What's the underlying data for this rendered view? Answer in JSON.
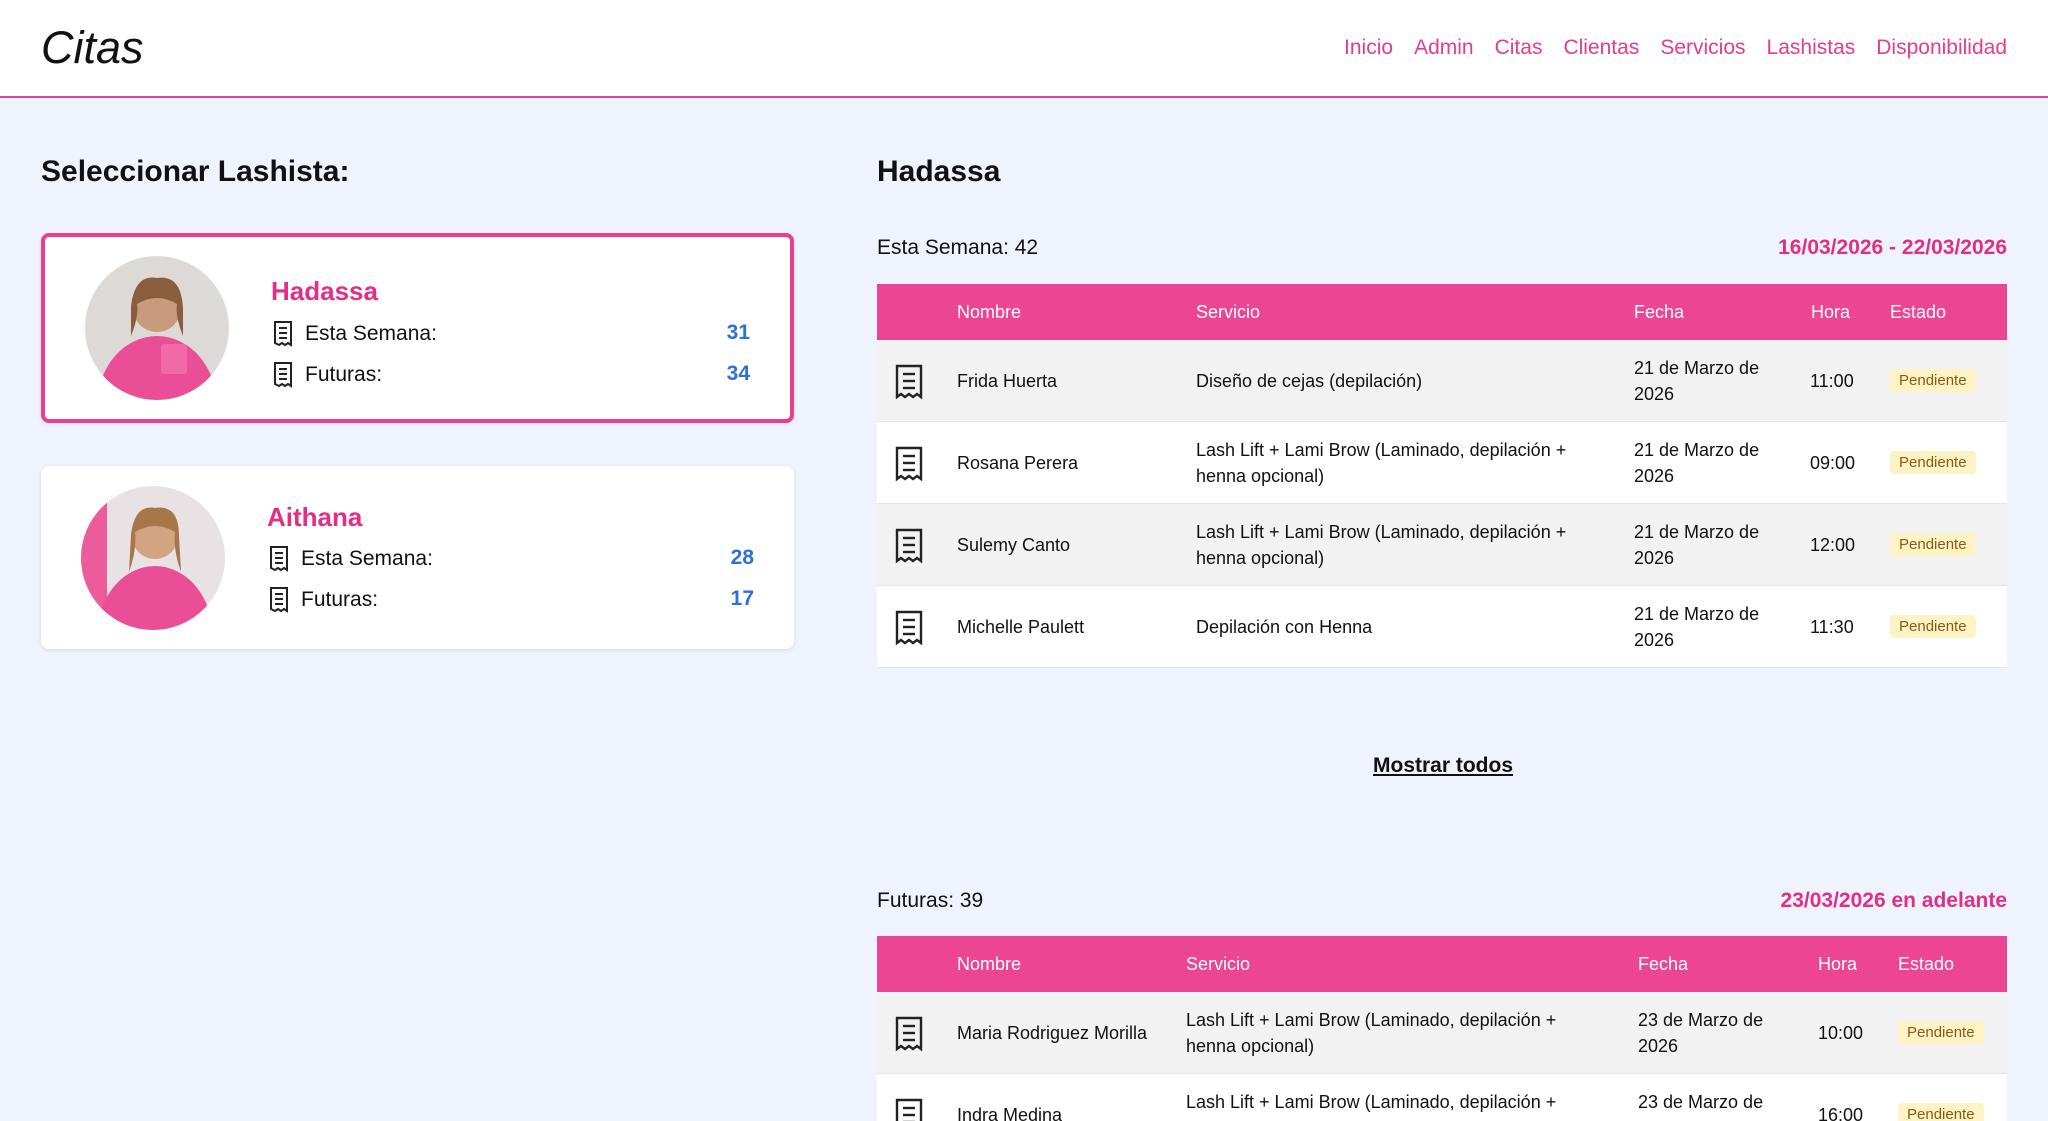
{
  "nav": {
    "brand": "Citas",
    "links": [
      "Inicio",
      "Admin",
      "Citas",
      "Clientas",
      "Servicios",
      "Lashistas",
      "Disponibilidad"
    ]
  },
  "left": {
    "title": "Seleccionar Lashista:",
    "lashistas": [
      {
        "name": "Hadassa",
        "week_label": "Esta Semana:",
        "week": "31",
        "future_label": "Futuras:",
        "future": "34",
        "selected": true
      },
      {
        "name": "Aithana",
        "week_label": "Esta Semana:",
        "week": "28",
        "future_label": "Futuras:",
        "future": "17",
        "selected": false
      }
    ]
  },
  "right": {
    "title": "Hadassa",
    "week": {
      "label": "Esta Semana: 42",
      "range": "16/03/2026 - 22/03/2026",
      "headers": {
        "nombre": "Nombre",
        "servicio": "Servicio",
        "fecha": "Fecha",
        "hora": "Hora",
        "estado": "Estado"
      },
      "rows": [
        {
          "nombre": "Frida Huerta",
          "servicio": "Diseño de cejas (depilación)",
          "fecha1": "21 de Marzo de",
          "fecha2": "2026",
          "hora": "11:00",
          "estado": "Pendiente"
        },
        {
          "nombre": "Rosana Perera",
          "servicio1": "Lash Lift + Lami Brow (Laminado, depilación +",
          "servicio2": "henna opcional)",
          "fecha1": "21 de Marzo de",
          "fecha2": "2026",
          "hora": "09:00",
          "estado": "Pendiente"
        },
        {
          "nombre": "Sulemy Canto",
          "servicio1": "Lash Lift + Lami Brow (Laminado, depilación +",
          "servicio2": "henna opcional)",
          "fecha1": "21 de Marzo de",
          "fecha2": "2026",
          "hora": "12:00",
          "estado": "Pendiente"
        },
        {
          "nombre": "Michelle Paulett",
          "servicio": "Depilación con Henna",
          "fecha1": "21 de Marzo de",
          "fecha2": "2026",
          "hora": "11:30",
          "estado": "Pendiente"
        }
      ],
      "show_all": "Mostrar todos"
    },
    "future": {
      "label": "Futuras: 39",
      "range": "23/03/2026 en adelante",
      "headers": {
        "nombre": "Nombre",
        "servicio": "Servicio",
        "fecha": "Fecha",
        "hora": "Hora",
        "estado": "Estado"
      },
      "rows": [
        {
          "nombre": "Maria Rodriguez Morilla",
          "servicio1": "Lash Lift + Lami Brow (Laminado, depilación +",
          "servicio2": "henna opcional)",
          "fecha1": "23 de Marzo de",
          "fecha2": "2026",
          "hora": "10:00",
          "estado": "Pendiente"
        },
        {
          "nombre": "Indra Medina",
          "servicio1": "Lash Lift + Lami Brow (Laminado, depilación +",
          "servicio2": "",
          "fecha1": "23 de Marzo de",
          "fecha2": "",
          "hora": "16:00",
          "estado": "Pendiente"
        }
      ]
    }
  },
  "colors": {
    "accent": "#e8408f",
    "link": "#e53c8c",
    "value": "#2f6fd8",
    "background": "#eff3fe",
    "badge": "#fdf3c4"
  }
}
